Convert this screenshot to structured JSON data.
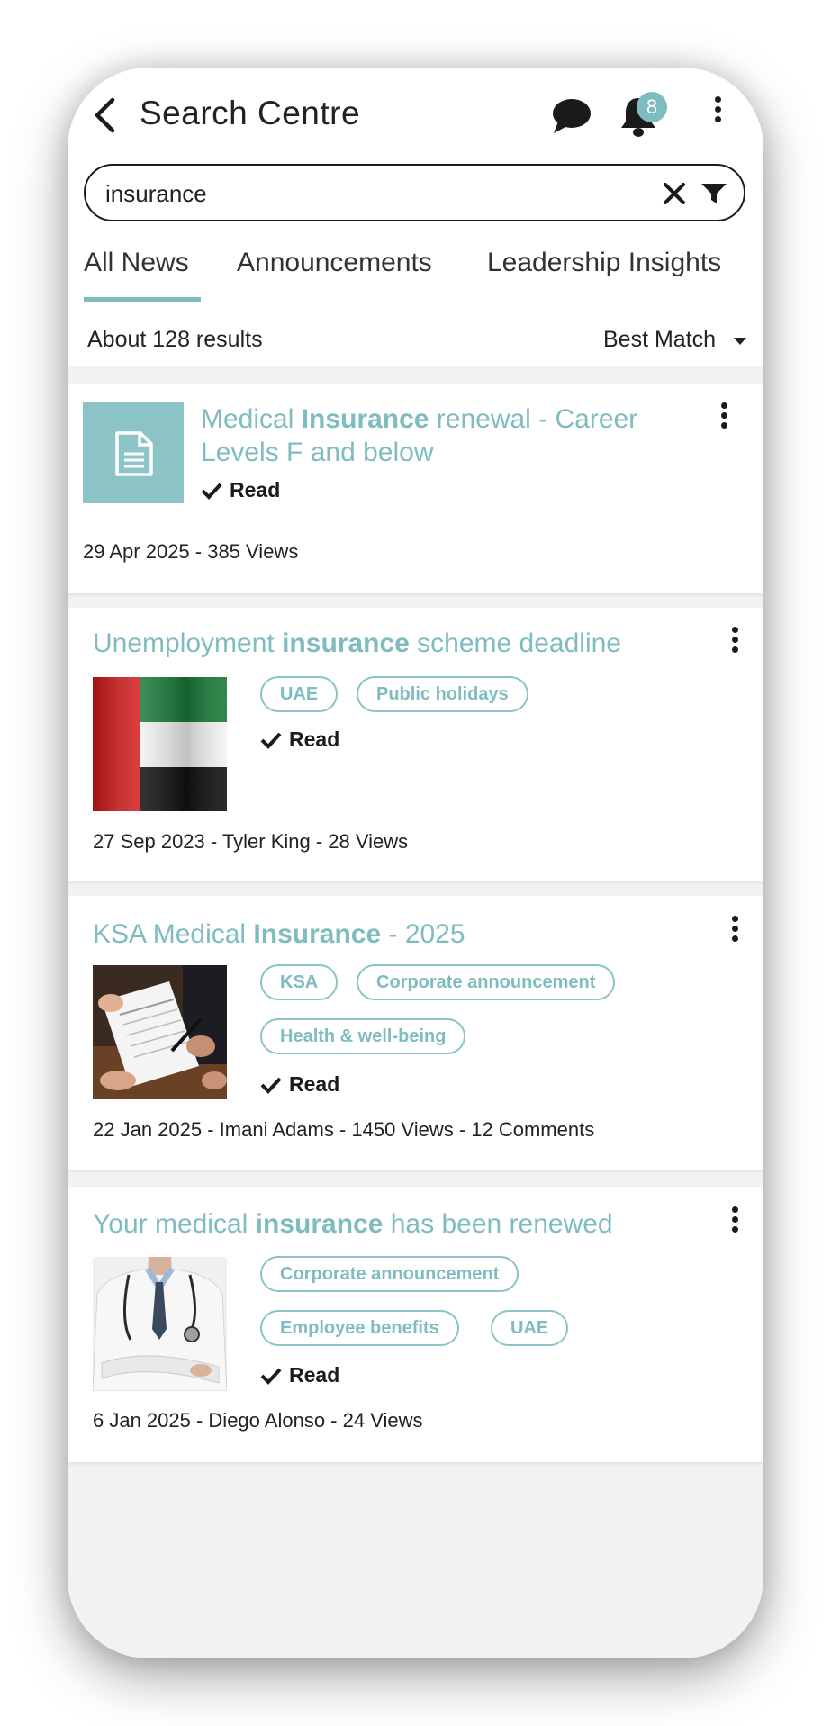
{
  "header": {
    "title": "Search Centre",
    "notification_count": "8"
  },
  "search": {
    "query": "insurance"
  },
  "tabs": [
    {
      "label": "All News"
    },
    {
      "label": "Announcements"
    },
    {
      "label": "Leadership Insights"
    }
  ],
  "results": {
    "count_text": "About 128 results",
    "sort_label": "Best Match"
  },
  "cards": [
    {
      "title_pre": "Medical ",
      "title_bold": "Insurance",
      "title_post": " renewal - Career Levels F and below",
      "status": "Read",
      "meta": "29 Apr 2025 - 385 Views",
      "thumbnail": "document-icon"
    },
    {
      "title_pre": "Unemployment ",
      "title_bold": "insurance",
      "title_post": " scheme deadline",
      "tags": [
        "UAE",
        "Public holidays"
      ],
      "status": "Read",
      "meta": "27 Sep 2023 - Tyler King - 28 Views",
      "thumbnail": "uae-flag-image"
    },
    {
      "title_pre": "KSA Medical ",
      "title_bold": "Insurance",
      "title_post": " - 2025",
      "tags": [
        "KSA",
        "Corporate announcement",
        "Health & well-being"
      ],
      "status": "Read",
      "meta": "22 Jan 2025 - Imani Adams - 1450 Views - 12 Comments",
      "thumbnail": "signing-document-image"
    },
    {
      "title_pre": "Your medical ",
      "title_bold": "insurance",
      "title_post": " has been renewed",
      "tags": [
        "Corporate announcement",
        "Employee benefits",
        "UAE"
      ],
      "status": "Read",
      "meta": "6 Jan 2025 - Diego Alonso - 24 Views",
      "thumbnail": "doctor-image"
    }
  ],
  "colors": {
    "accent": "#7fbcc0",
    "text": "#222222",
    "background": "#f2f2f2"
  }
}
